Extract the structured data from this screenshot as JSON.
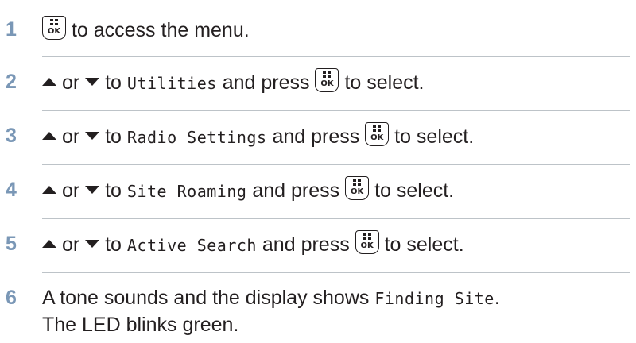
{
  "steps": [
    {
      "number": "1",
      "after_ok": "to access the menu."
    },
    {
      "number": "2",
      "or": "or",
      "to": "to",
      "menu_item": "Utilities",
      "press": "and press",
      "after_ok": "to select."
    },
    {
      "number": "3",
      "or": "or",
      "to": "to",
      "menu_item": "Radio Settings",
      "press": "and press",
      "after_ok": "to select."
    },
    {
      "number": "4",
      "or": "or",
      "to": "to",
      "menu_item": "Site Roaming",
      "press": "and press",
      "after_ok": "to select."
    },
    {
      "number": "5",
      "or": "or",
      "to": "to",
      "menu_item": "Active Search",
      "press": "and press",
      "after_ok": "to select."
    },
    {
      "number": "6",
      "line1_text": "A tone sounds and the display shows",
      "display_text": "Finding Site",
      "line1_end": ".",
      "line2_text": "The LED blinks green."
    }
  ],
  "icons": {
    "ok_button": "menu-ok-button-icon",
    "ok_label": "OK",
    "up": "up-arrow-icon",
    "down": "down-arrow-icon"
  }
}
